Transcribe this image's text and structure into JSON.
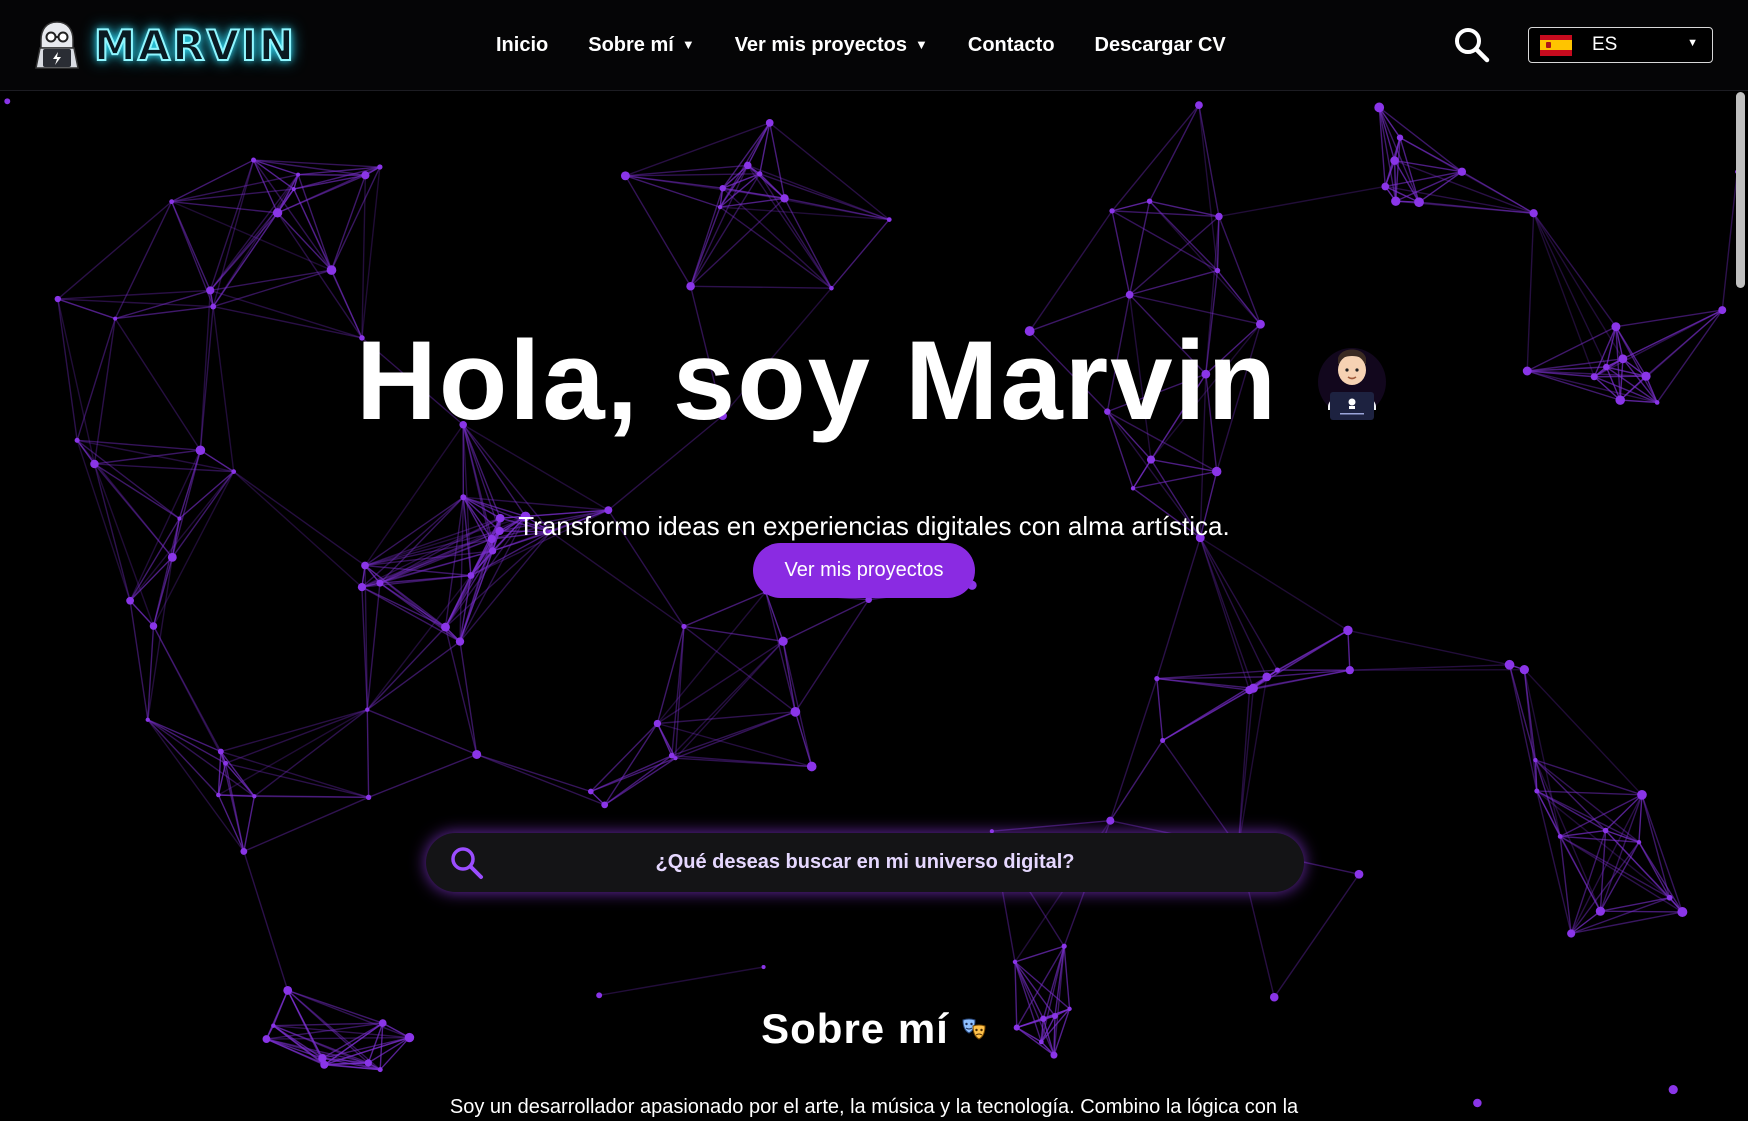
{
  "header": {
    "logo_text": "MARVIN",
    "nav": [
      {
        "label": "Inicio",
        "has_dropdown": false
      },
      {
        "label": "Sobre mí",
        "has_dropdown": true
      },
      {
        "label": "Ver mis proyectos",
        "has_dropdown": true
      },
      {
        "label": "Contacto",
        "has_dropdown": false
      },
      {
        "label": "Descargar CV",
        "has_dropdown": false
      }
    ],
    "search_icon": "search-icon",
    "language": {
      "selected": "ES",
      "flag_icon": "spain-flag-icon"
    }
  },
  "hero": {
    "title": "Hola, soy Marvin",
    "title_icon": "developer-with-laptop-emoji",
    "subtitle": "Transformo ideas en experiencias digitales con alma artística.",
    "cta_label": "Ver mis proyectos"
  },
  "search": {
    "placeholder": "¿Qué deseas buscar en mi universo digital?",
    "icon": "search-icon"
  },
  "about": {
    "heading": "Sobre mí",
    "heading_icon": "theater-masks-icon",
    "text": "Soy un desarrollador apasionado por el arte, la música y la tecnología. Combino la lógica con la emoción para crear experiencias únicas."
  },
  "colors": {
    "background": "#000000",
    "accent": "#8a2be2",
    "network_line": "#7b2fd0",
    "logo_glow": "#38e8ff"
  }
}
